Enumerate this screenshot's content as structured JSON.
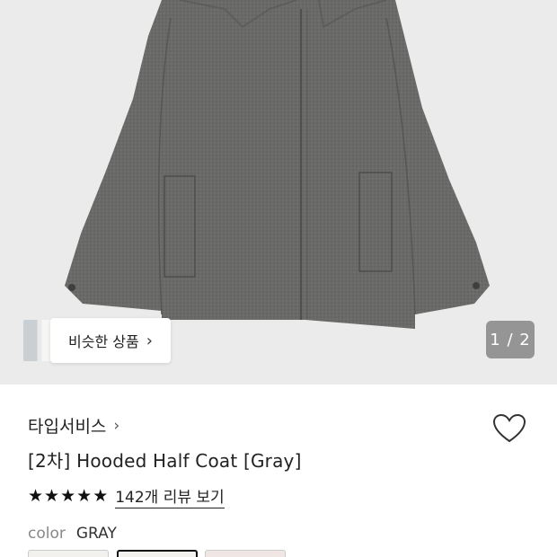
{
  "similar": {
    "label": "비슷한 상품",
    "chevron": "›"
  },
  "pager": {
    "text": "1 / 2"
  },
  "product": {
    "brand": "타입서비스",
    "brand_chevron": "›",
    "title": "[2차] Hooded Half Coat [Gray]",
    "rating_stars": 5,
    "review_link": "142개 리뷰 보기",
    "color_label": "color",
    "color_value": "GRAY"
  },
  "colors": {
    "hero_bg": "#ebebeb",
    "coat": "#6b6b69"
  },
  "icons": {
    "heart": "heart-outline-icon",
    "star": "star-filled-icon",
    "chevron": "chevron-right-icon"
  }
}
